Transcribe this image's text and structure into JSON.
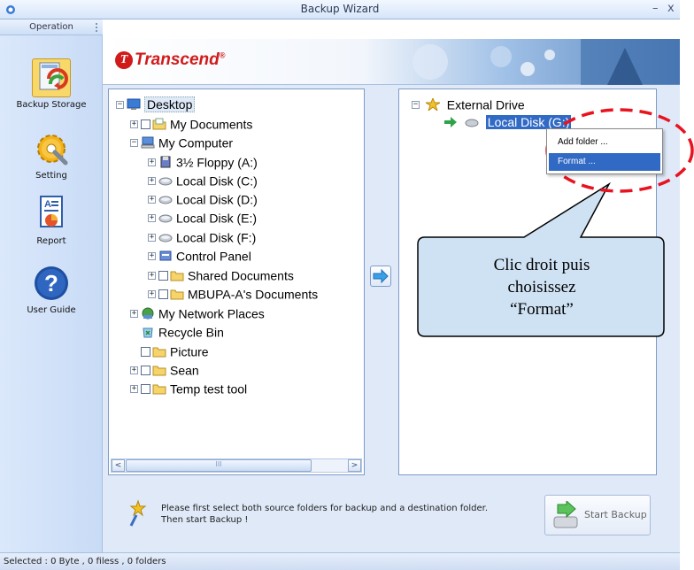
{
  "window": {
    "title": "Backup Wizard",
    "minimize_glyph": "–",
    "close_glyph": "x"
  },
  "sidebar": {
    "header": "Operation",
    "items": [
      {
        "label": "Backup Storage",
        "icon": "backup-storage-icon",
        "active": true
      },
      {
        "label": "Setting",
        "icon": "gear-icon"
      },
      {
        "label": "Report",
        "icon": "report-icon"
      },
      {
        "label": "User Guide",
        "icon": "help-icon"
      }
    ]
  },
  "banner": {
    "brand": "Transcend",
    "brand_mark": "T",
    "brand_reg": "®",
    "brand_color": "#d11b1b"
  },
  "source_tree": {
    "nodes": [
      {
        "label": "Desktop",
        "icon": "desktop-icon",
        "expander": "−"
      },
      {
        "label": "My Documents",
        "icon": "documents-folder-icon",
        "expander": "+"
      },
      {
        "label": "My Computer",
        "icon": "computer-icon",
        "expander": "−"
      },
      {
        "label": "3½ Floppy (A:)",
        "icon": "floppy-icon",
        "expander": "+"
      },
      {
        "label": "Local Disk (C:)",
        "icon": "disk-icon",
        "expander": "+"
      },
      {
        "label": "Local Disk (D:)",
        "icon": "disk-icon",
        "expander": "+"
      },
      {
        "label": "Local Disk (E:)",
        "icon": "disk-icon",
        "expander": "+"
      },
      {
        "label": "Local Disk (F:)",
        "icon": "disk-icon",
        "expander": "+"
      },
      {
        "label": "Control Panel",
        "icon": "control-panel-icon",
        "expander": "+"
      },
      {
        "label": "Shared Documents",
        "icon": "folder-icon",
        "expander": "+"
      },
      {
        "label": "MBUPA-A's Documents",
        "icon": "folder-icon",
        "expander": "+"
      },
      {
        "label": "My Network Places",
        "icon": "network-icon",
        "expander": "+"
      },
      {
        "label": "Recycle Bin",
        "icon": "recycle-bin-icon",
        "expander": ""
      },
      {
        "label": "Picture",
        "icon": "folder-icon",
        "expander": ""
      },
      {
        "label": "Sean",
        "icon": "folder-icon",
        "expander": "+"
      },
      {
        "label": "Temp test tool",
        "icon": "folder-icon",
        "expander": "+"
      }
    ]
  },
  "dest_tree": {
    "root": "External Drive",
    "root_expander": "−",
    "child": "Local Disk (G:)"
  },
  "context_menu": {
    "items": [
      "Add folder ...",
      "Format ..."
    ],
    "highlighted": 1
  },
  "scrollbar": {
    "left_glyph": "<",
    "right_glyph": ">",
    "thumb_glyph": "III"
  },
  "transfer_button": {
    "icon": "right-arrow-icon"
  },
  "info": {
    "text": "Please first select both source folders for backup and a destination folder. Then start Backup !"
  },
  "start_button": {
    "label": "Start Backup"
  },
  "callout": {
    "line1": "Clic droit puis",
    "line2": "choisissez",
    "line3": "“Format”"
  },
  "status": {
    "text": "Selected : 0 Byte , 0 filess , 0 folders"
  },
  "colors": {
    "accent_red": "#e8131f",
    "selection_blue": "#316ac5"
  }
}
